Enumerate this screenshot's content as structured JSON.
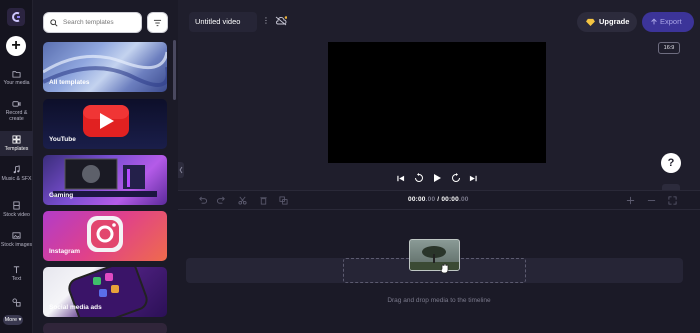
{
  "app": {
    "colors": {
      "accent": "#3c3499",
      "rail_bg": "#15141f",
      "panel_bg": "#1b1a27",
      "main_bg": "#1f1e2c"
    }
  },
  "rail": {
    "items": [
      {
        "label": "Your media",
        "icon": "folder-icon"
      },
      {
        "label": "Record & create",
        "icon": "camera-icon"
      },
      {
        "label": "Templates",
        "icon": "templates-icon",
        "active": true
      },
      {
        "label": "Music & SFX",
        "icon": "music-note-icon"
      },
      {
        "label": "Stock video",
        "icon": "film-icon"
      },
      {
        "label": "Stock images",
        "icon": "image-icon"
      },
      {
        "label": "Text",
        "icon": "text-icon"
      },
      {
        "label": "",
        "icon": "shapes-icon"
      }
    ],
    "more_label": "More"
  },
  "panel": {
    "search_placeholder": "Search templates",
    "templates": [
      {
        "label": "All templates"
      },
      {
        "label": "YouTube"
      },
      {
        "label": "Gaming"
      },
      {
        "label": "Instagram"
      },
      {
        "label": "Social media ads"
      }
    ]
  },
  "header": {
    "video_title": "Untitled video",
    "upgrade_label": "Upgrade",
    "export_label": "Export",
    "aspect_ratio": "16:9"
  },
  "timeline": {
    "time_current": "00:00",
    "time_current_frac": ".00",
    "time_separator": "/",
    "time_total": "00:00",
    "time_total_frac": ".00",
    "drop_hint": "Drag and drop media to the timeline"
  },
  "help_label": "?"
}
